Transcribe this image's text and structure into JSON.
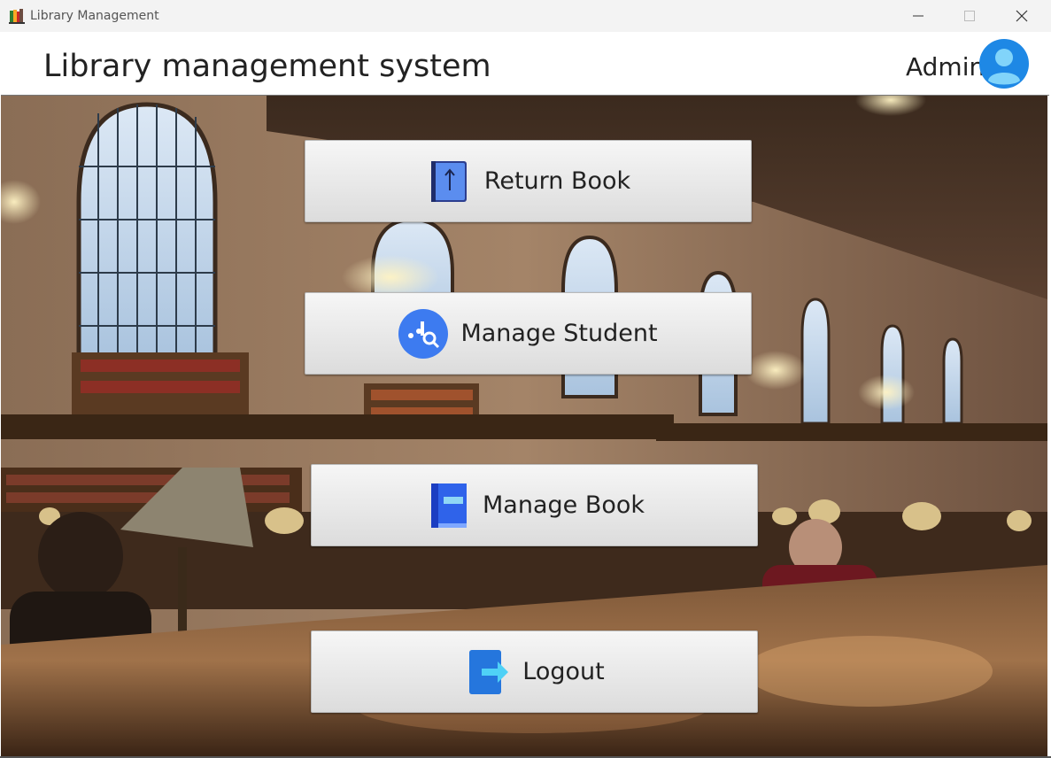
{
  "window": {
    "title": "Library Management",
    "icon": "books-icon",
    "controls": [
      "minimize-icon",
      "maximize-icon",
      "close-icon"
    ]
  },
  "header": {
    "title": "Library management system",
    "user_name": "Admin",
    "avatar_icon": "user-avatar-icon",
    "accent_color": "#1e88e5"
  },
  "menu": {
    "return_book": {
      "label": "Return Book",
      "icon": "return-book-icon"
    },
    "manage_student": {
      "label": "Manage Student",
      "icon": "manage-student-icon"
    },
    "manage_book": {
      "label": "Manage Book",
      "icon": "manage-book-icon"
    },
    "logout": {
      "label": "Logout",
      "icon": "logout-icon"
    }
  },
  "background": {
    "description_icon": "library-reading-room-photo"
  }
}
